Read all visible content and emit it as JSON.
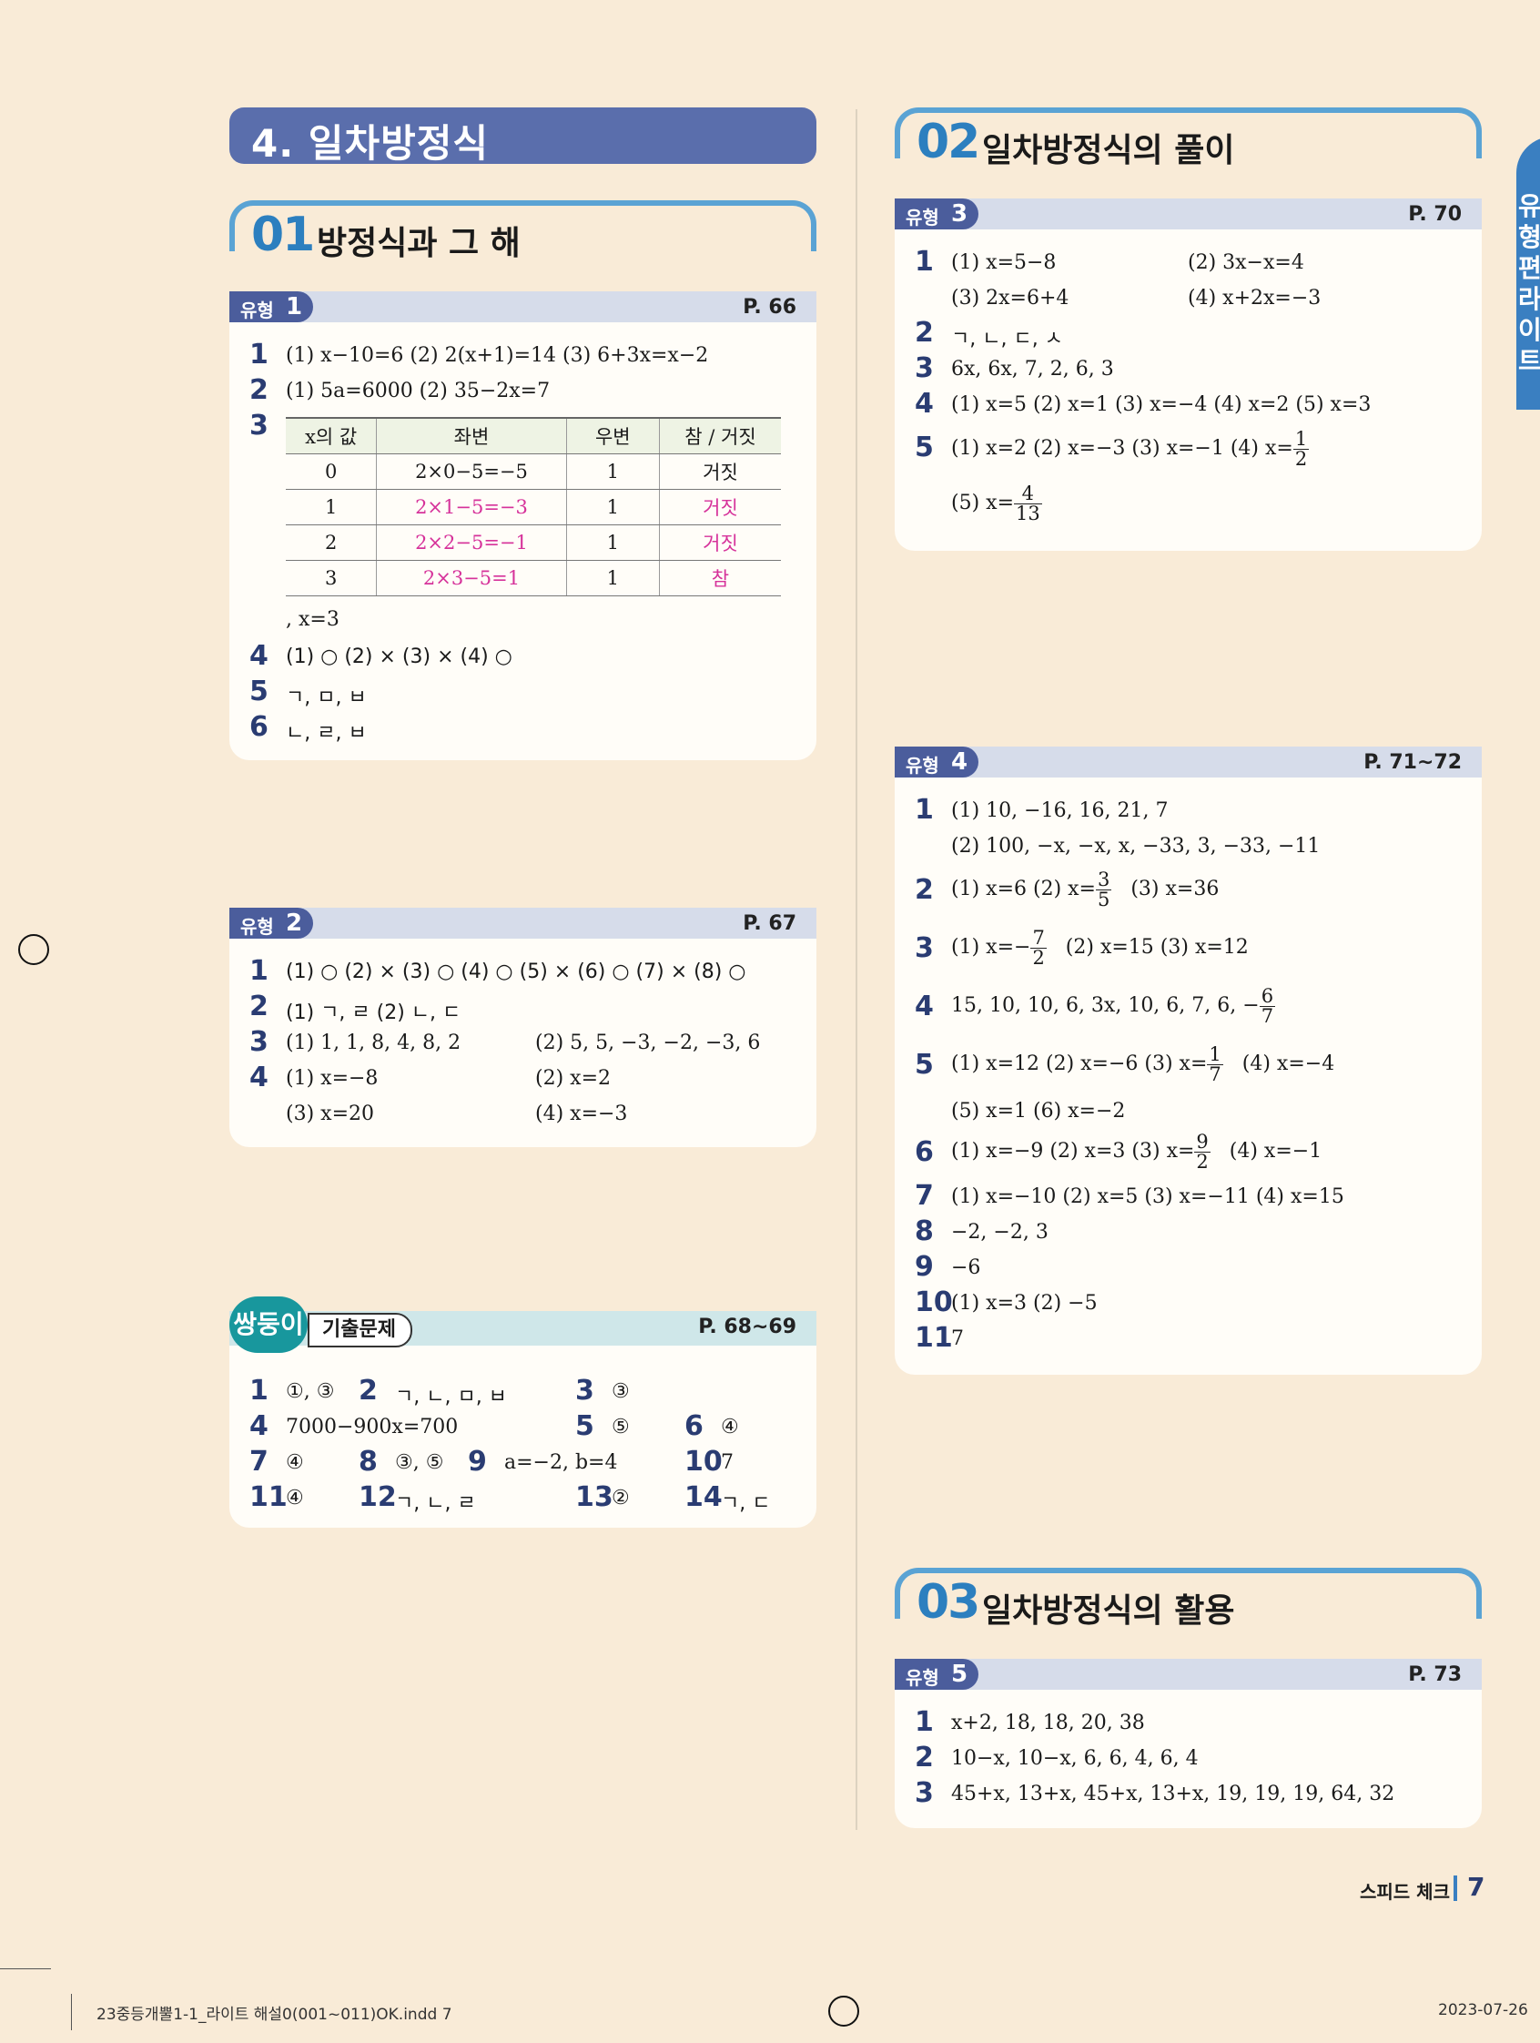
{
  "chapter": "4. 일차방정식",
  "sections": [
    {
      "num": "01",
      "title": "방정식과 그 해"
    },
    {
      "num": "02",
      "title": "일차방정식의 풀이"
    },
    {
      "num": "03",
      "title": "일차방정식의 활용"
    }
  ],
  "type_label": "유형",
  "c1": {
    "n": "1",
    "page": "P. 66",
    "q1": "(1) x−10=6   (2) 2(x+1)=14   (3) 6+3x=x−2",
    "q2": "(1) 5a=6000   (2) 35−2x=7",
    "table_head": [
      "x의 값",
      "좌변",
      "우변",
      "참 / 거짓"
    ],
    "table_rows": [
      [
        "0",
        "2×0−5=−5",
        "1",
        "거짓"
      ],
      [
        "1",
        "2×1−5=−3",
        "1",
        "거짓"
      ],
      [
        "2",
        "2×2−5=−1",
        "1",
        "거짓"
      ],
      [
        "3",
        "2×3−5=1",
        "1",
        "참"
      ]
    ],
    "q3_tail": ", x=3",
    "q4": "(1) ○   (2) ×   (3) ×   (4) ○",
    "q5": "ㄱ, ㅁ, ㅂ",
    "q6": "ㄴ, ㄹ, ㅂ"
  },
  "c2": {
    "n": "2",
    "page": "P. 67",
    "q1": "(1) ○   (2) ×   (3) ○   (4) ○   (5) ×   (6) ○   (7) ×   (8) ○",
    "q2": "(1) ㄱ, ㄹ   (2) ㄴ, ㄷ",
    "q3a": "(1) 1, 1, 8, 4, 8, 2",
    "q3b": "(2) 5, 5, −3, −2, −3, 6",
    "q4a": "(1) x=−8",
    "q4b": "(2) x=2",
    "q4c": "(3) x=20",
    "q4d": "(4) x=−3"
  },
  "twin": {
    "badge": "쌍둥이",
    "label": "기출문제",
    "page": "P. 68∼69",
    "a1": "①, ③",
    "a2": "ㄱ, ㄴ, ㅁ, ㅂ",
    "a3": "③",
    "a4": "7000−900x=700",
    "a5": "⑤",
    "a6": "④",
    "a7": "④",
    "a8": "③, ⑤",
    "a9": "a=−2, b=4",
    "a10": "7",
    "a11": "④",
    "a12": "ㄱ, ㄴ, ㄹ",
    "a13": "②",
    "a14": "ㄱ, ㄷ"
  },
  "c3": {
    "n": "3",
    "page": "P. 70",
    "q1a": "(1) x=5−8",
    "q1b": "(2) 3x−x=4",
    "q1c": "(3) 2x=6+4",
    "q1d": "(4) x+2x=−3",
    "q2": "ㄱ, ㄴ, ㄷ, ㅅ",
    "q3": "6x, 6x, 7, 2, 6, 3",
    "q4": "(1) x=5   (2) x=1   (3) x=−4   (4) x=2   (5) x=3",
    "q5": "(1) x=2    (2) x=−3   (3) x=−1   (4) x=",
    "q5_f_n": "1",
    "q5_f_d": "2",
    "q5b": "(5) x=",
    "q5b_f_n": "4",
    "q5b_f_d": "13"
  },
  "c4": {
    "n": "4",
    "page": "P. 71∼72",
    "q1a": "(1) 10, −16, 16, 21, 7",
    "q1b": "(2) 100, −x, −x, x, −33, 3, −33, −11",
    "q2a": "(1) x=6   (2) x=",
    "q2_f_n": "3",
    "q2_f_d": "5",
    "q2b": "(3) x=36",
    "q3a": "(1) x=−",
    "q3_f_n": "7",
    "q3_f_d": "2",
    "q3b": "(2) x=15   (3) x=12",
    "q4a": "15, 10, 10, 6, 3x, 10, 6, 7, 6, −",
    "q4_f_n": "6",
    "q4_f_d": "7",
    "q5a": "(1) x=12   (2) x=−6   (3) x=",
    "q5_f_n": "1",
    "q5_f_d": "7",
    "q5b": "(4) x=−4",
    "q5c": "(5) x=1    (6) x=−2",
    "q6a": "(1) x=−9   (2) x=3   (3) x=",
    "q6_f_n": "9",
    "q6_f_d": "2",
    "q6b": "(4) x=−1",
    "q7": "(1) x=−10   (2) x=5   (3) x=−11   (4) x=15",
    "q8": "−2, −2, 3",
    "q9": "−6",
    "q10": "(1) x=3   (2) −5",
    "q11": "7"
  },
  "c5": {
    "n": "5",
    "page": "P. 73",
    "q1": "x+2, 18, 18, 20, 38",
    "q2": "10−x, 10−x, 6, 6, 4, 6, 4",
    "q3": "45+x, 13+x, 45+x, 13+x, 19, 19, 19, 64, 32"
  },
  "side_label": "유형편 라이트",
  "footer": {
    "section": "스피드 체크",
    "page": "7",
    "file": "23중등개뿔1-1_라이트 해설0(001~011)OK.indd   7",
    "date": "2023-07-26"
  }
}
